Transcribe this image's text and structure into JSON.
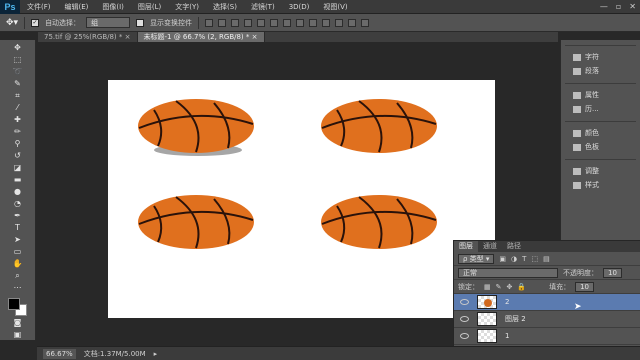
{
  "app": {
    "logo": "Ps"
  },
  "menu": [
    "文件(F)",
    "编辑(E)",
    "图像(I)",
    "图层(L)",
    "文字(Y)",
    "选择(S)",
    "滤镜(T)",
    "3D(D)",
    "视图(V)"
  ],
  "window_controls": {
    "minimize": "—",
    "restore": "▫",
    "close": "✕"
  },
  "options": {
    "auto_select_label": "自动选择：",
    "auto_select_value": "组",
    "show_transform_label": "显示变换控件"
  },
  "tabs": [
    {
      "label": "75.tif @ 25%(RGB/8) *",
      "close": "×"
    },
    {
      "label": "未标题-1 @ 66.7% (2, RGB/8) *",
      "close": "×"
    }
  ],
  "status": {
    "zoom": "66.67%",
    "doc": "文档:1.37M/5.00M"
  },
  "right_panel": [
    {
      "icon": "char-icon",
      "label": "字符"
    },
    {
      "icon": "paragraph-icon",
      "label": "段落"
    },
    {
      "icon": "properties-icon",
      "label": "属性"
    },
    {
      "icon": "history-icon",
      "label": "历..."
    },
    {
      "icon": "swatches-icon",
      "label": "色板"
    },
    {
      "icon": "adjustments-icon",
      "label": "调整"
    },
    {
      "icon": "styles-icon",
      "label": "样式"
    }
  ],
  "layers": {
    "tabs": [
      "图层",
      "通道",
      "路径"
    ],
    "filter_label": "类型",
    "blend_mode": "正常",
    "opacity_label": "不透明度：",
    "opacity_value": "10",
    "lock_label": "锁定：",
    "fill_label": "填充：",
    "fill_value": "10",
    "items": [
      {
        "name": "2",
        "selected": true
      },
      {
        "name": "图层 2",
        "selected": false
      },
      {
        "name": "1",
        "selected": false
      }
    ]
  },
  "colors": {
    "foreground": "#000000",
    "background": "#ffffff",
    "basketball": "#e0701e"
  }
}
